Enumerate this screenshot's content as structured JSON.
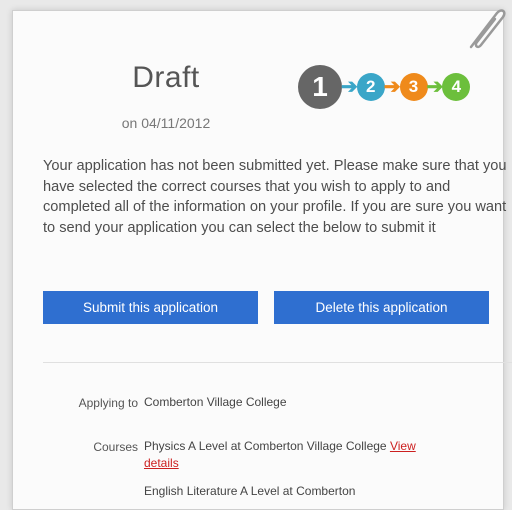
{
  "status": {
    "title": "Draft",
    "date": "on 04/11/2012"
  },
  "progress": {
    "steps": [
      {
        "number": "1",
        "color": "#666666"
      },
      {
        "number": "2",
        "color": "#3aa6c8"
      },
      {
        "number": "3",
        "color": "#ef8a1b"
      },
      {
        "number": "4",
        "color": "#6cbf3c"
      }
    ],
    "arrow_glyph": "➔",
    "arrow_colors": [
      "#3aa6c8",
      "#ef8a1b",
      "#6cbf3c"
    ]
  },
  "message": "Your application has not been submitted yet. Please make sure that you have selected the correct courses that you wish to apply to and completed all of the information on your profile. If you are sure you want to send your application you can select the below to submit it",
  "actions": {
    "submit_label": "Submit this application",
    "delete_label": "Delete this application",
    "button_color": "#2f6fd0"
  },
  "details": {
    "applying_to_label": "Applying to",
    "applying_to_value": "Comberton Village College",
    "courses_label": "Courses",
    "courses": [
      {
        "text": "Physics A Level at Comberton Village College",
        "link": "View details"
      },
      {
        "text": "English Literature A Level at Comberton"
      }
    ]
  },
  "icons": {
    "corner": "paperclip-icon"
  },
  "colors": {
    "link": "#cc1f1f"
  }
}
